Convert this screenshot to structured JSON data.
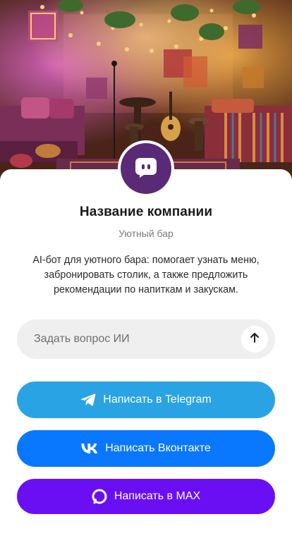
{
  "colors": {
    "avatar_bg": "#5b2a77",
    "telegram": "#2aa3e4",
    "vk": "#0a77ff",
    "max": "#6a0ff3",
    "input_bg": "#efefef"
  },
  "cover": {
    "icon": "bar-interior-photo"
  },
  "company": {
    "avatar_icon": "chat-bubble-icon",
    "name": "Название компании",
    "subtitle": "Уютный бар",
    "description": "AI-бот для уютного бара: помогает узнать меню, забронировать столик, а также предложить рекомендации по напиткам и закускам."
  },
  "ask": {
    "placeholder": "Задать вопрос ИИ",
    "value": "",
    "send_icon": "arrow-up-icon"
  },
  "buttons": {
    "telegram": {
      "label": "Написать в Telegram",
      "icon": "telegram-icon"
    },
    "vk": {
      "label": "Написать Вконтакте",
      "icon": "vk-icon"
    },
    "max": {
      "label": "Написать в MAX",
      "icon": "max-icon"
    }
  }
}
